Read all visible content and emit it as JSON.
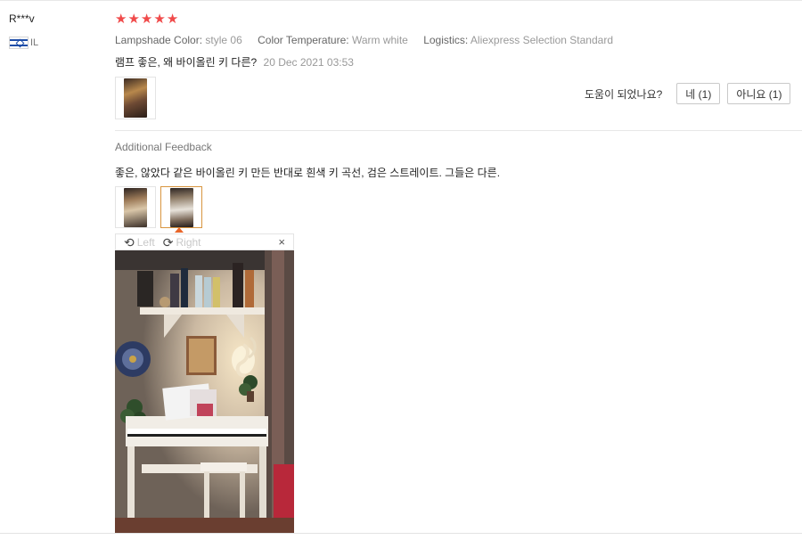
{
  "reviewer": {
    "name": "R***v",
    "country": "IL"
  },
  "rating": {
    "stars": 5,
    "star_glyph": "★"
  },
  "attributes": [
    {
      "key": "Lampshade Color:",
      "value": "style 06"
    },
    {
      "key": "Color Temperature:",
      "value": "Warm white"
    },
    {
      "key": "Logistics:",
      "value": "Aliexpress Selection Standard"
    }
  ],
  "review": {
    "text": "램프 좋은, 왜 바이올린 키 다른?",
    "date": "20 Dec 2021 03:53"
  },
  "helpful": {
    "question": "도움이 되었나요?",
    "yes_label": "네 (1)",
    "no_label": "아니요 (1)"
  },
  "additional_feedback": {
    "title": "Additional Feedback",
    "text": "좋은, 않았다 같은 바이올린 키 만든 반대로 흰색 키 곡선, 검은 스트레이트. 그들은 다른."
  },
  "viewer": {
    "left_label": "Left",
    "right_label": "Right",
    "close_glyph": "×",
    "rotate_left_glyph": "⟲",
    "rotate_right_glyph": "⟳"
  },
  "colors": {
    "accent": "#e8662a",
    "stars": "#f04a4a",
    "active_thumb_border": "#d8953f"
  }
}
